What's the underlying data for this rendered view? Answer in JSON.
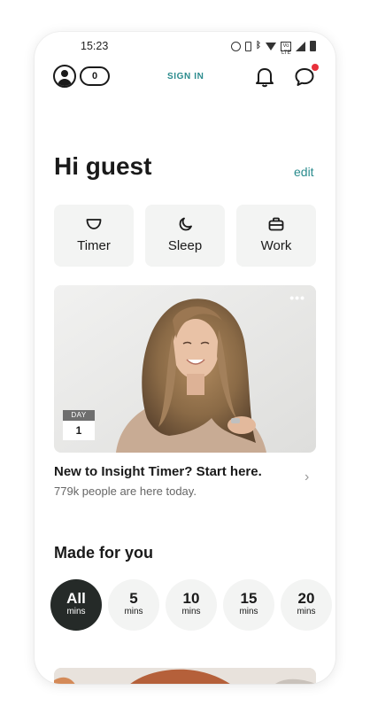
{
  "status_bar": {
    "time": "15:23",
    "volte_label": "Vo LTE"
  },
  "header": {
    "follower_count": "0",
    "sign_in_label": "SIGN IN"
  },
  "greeting": {
    "title": "Hi guest",
    "edit_label": "edit"
  },
  "quick_actions": [
    {
      "label": "Timer",
      "icon": "bowl-icon"
    },
    {
      "label": "Sleep",
      "icon": "moon-icon"
    },
    {
      "label": "Work",
      "icon": "briefcase-icon"
    }
  ],
  "feature_card": {
    "more_label": "•••",
    "day_label": "DAY",
    "day_number": "1",
    "title": "New to Insight Timer? Start here.",
    "subtitle": "779k people are here today.",
    "chevron": "›"
  },
  "made_for_you": {
    "title": "Made for you",
    "durations": [
      {
        "value": "All",
        "unit": "mins",
        "selected": true
      },
      {
        "value": "5",
        "unit": "mins",
        "selected": false
      },
      {
        "value": "10",
        "unit": "mins",
        "selected": false
      },
      {
        "value": "15",
        "unit": "mins",
        "selected": false
      },
      {
        "value": "20",
        "unit": "mins",
        "selected": false
      }
    ]
  },
  "colors": {
    "accent": "#2a8b8d",
    "notification": "#e8303b",
    "selected_pill": "#252a28",
    "tile_background": "#f3f4f3"
  }
}
